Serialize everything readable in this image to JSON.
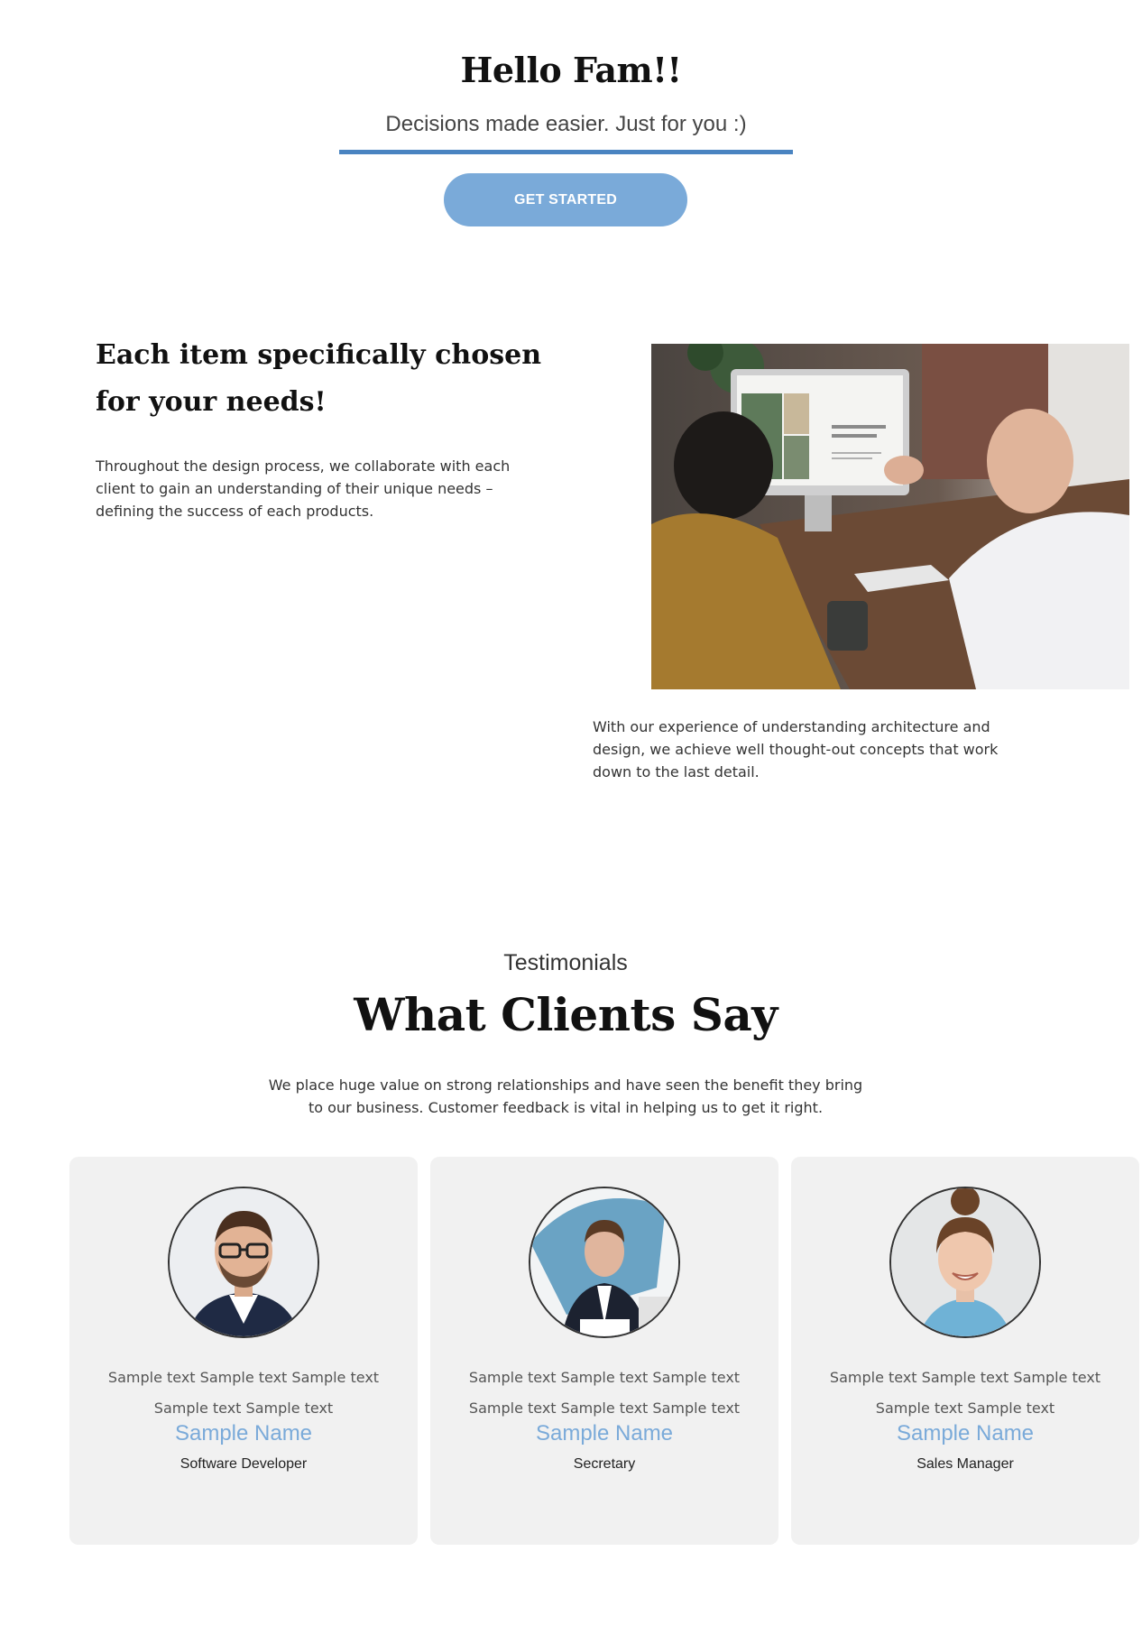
{
  "hero": {
    "title": "Hello Fam!!",
    "subtitle": "Decisions made easier. Just for you :)",
    "cta_label": "GET STARTED",
    "accent_color": "#7aaad9",
    "underline_color": "#4a84c1"
  },
  "feature": {
    "heading": "Each item specifically chosen for your needs!",
    "text": "Throughout the design process, we collaborate with each client to gain an understanding of their unique needs – defining the success of each products.",
    "image_icon": "office-meeting-photo",
    "text_2": "With our experience of understanding architecture and design, we achieve well thought-out concepts that work down to the last detail."
  },
  "testimonials": {
    "eyebrow": "Testimonials",
    "title": "What Clients Say",
    "intro": "We place huge value on strong relationships and have seen the benefit they bring to our business. Customer feedback is vital in helping us to get it right.",
    "cards": [
      {
        "quote": "Sample text Sample text Sample text Sample text Sample text",
        "name": "Sample Name",
        "role": "Software Developer",
        "avatar_icon": "man-with-glasses-avatar"
      },
      {
        "quote": "Sample text Sample text Sample text Sample text Sample text Sample text",
        "name": "Sample Name",
        "role": "Secretary",
        "avatar_icon": "man-in-suit-avatar"
      },
      {
        "quote": "Sample text Sample text Sample text Sample text Sample text",
        "name": "Sample Name",
        "role": "Sales Manager",
        "avatar_icon": "smiling-woman-avatar"
      }
    ]
  }
}
